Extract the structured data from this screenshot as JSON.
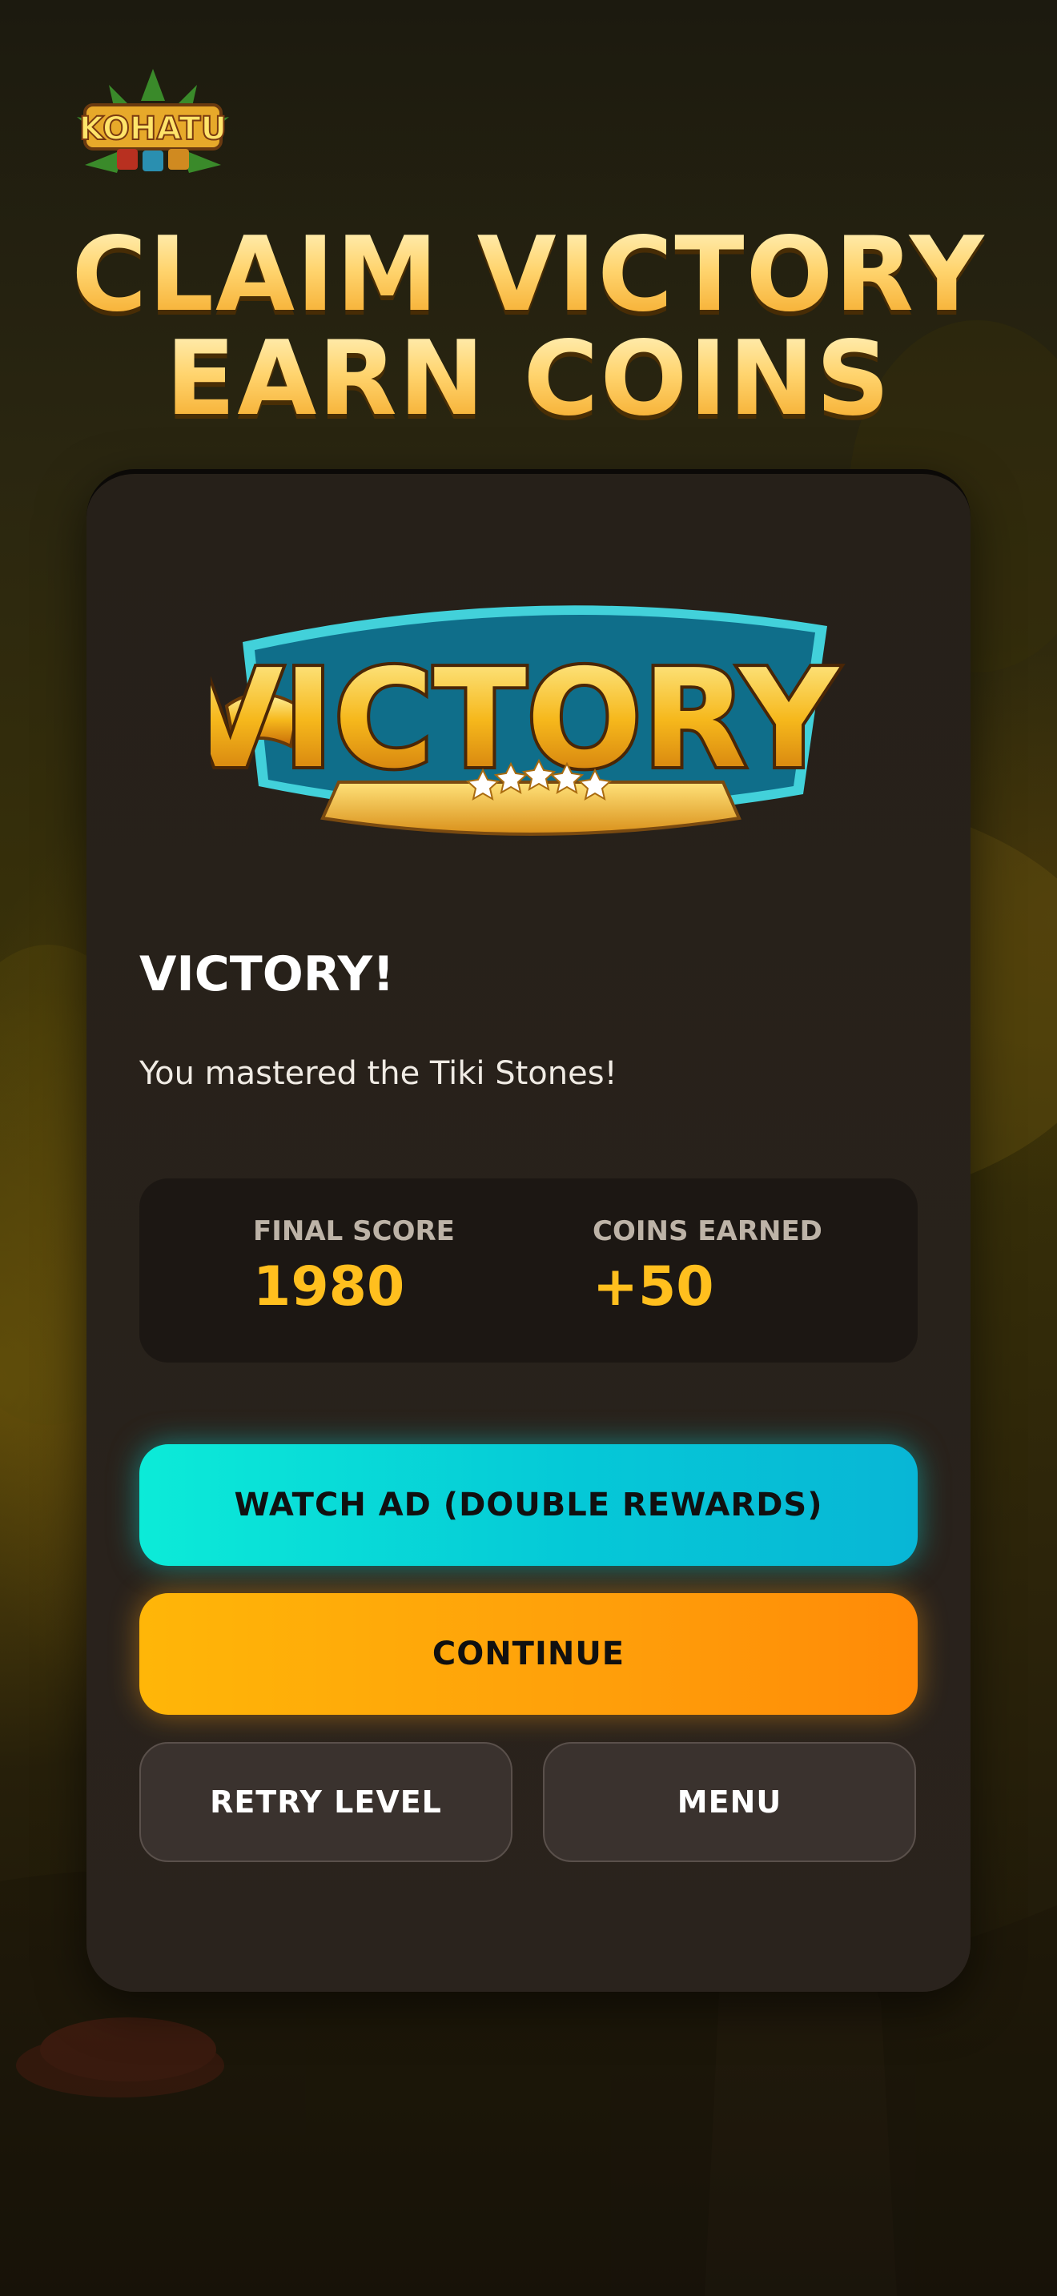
{
  "logo": {
    "text": "KOHATU"
  },
  "headline": {
    "line1": "CLAIM VICTORY",
    "line2": "EARN COINS"
  },
  "card": {
    "art_text": "VICTORY!",
    "title": "VICTORY!",
    "subtitle": "You mastered the Tiki Stones!",
    "stats": {
      "score_label": "FINAL SCORE",
      "score_value": "1980",
      "coins_label": "COINS EARNED",
      "coins_value": "+50"
    },
    "buttons": {
      "watch_ad": "WATCH AD (DOUBLE REWARDS)",
      "continue": "CONTINUE",
      "retry": "RETRY LEVEL",
      "menu": "MENU"
    }
  },
  "colors": {
    "accent_gold": "#ffbf1e",
    "headline_gold": "#fcd374",
    "cyan_button": "#0cebd8",
    "orange_button": "#ff9f0a",
    "card_bg": "#262019"
  }
}
